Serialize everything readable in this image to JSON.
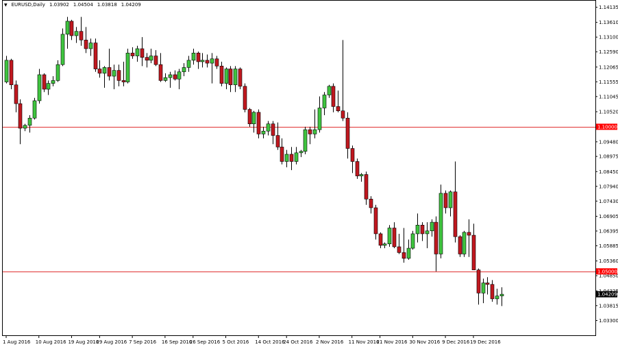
{
  "header": {
    "symbol": "EURUSD,Daily",
    "open": "1.03902",
    "high": "1.04504",
    "low": "1.03818",
    "close": "1.04209"
  },
  "colors": {
    "bull": "#3fc43f",
    "bear": "#c0181f",
    "wick": "#000000",
    "level_line": "#e03030",
    "level_label_bg": "#ff0000",
    "price_label_bg": "#000000"
  },
  "chart_data": {
    "type": "candlestick",
    "title": "EURUSD,Daily",
    "ylim": [
      1.0279,
      1.1436
    ],
    "y_ticks": [
      "1.14135",
      "1.13610",
      "1.13100",
      "1.12590",
      "1.12065",
      "1.11555",
      "1.11045",
      "1.10520",
      "1.09480",
      "1.08975",
      "1.08450",
      "1.07940",
      "1.07430",
      "1.06905",
      "1.06395",
      "1.05885",
      "1.05360",
      "1.04850",
      "1.04325",
      "1.03815",
      "1.03300"
    ],
    "x_tick_labels": [
      {
        "label": "1 Aug 2016",
        "i": 0
      },
      {
        "label": "10 Aug 2016",
        "i": 7
      },
      {
        "label": "19 Aug 2016",
        "i": 14
      },
      {
        "label": "29 Aug 2016",
        "i": 20
      },
      {
        "label": "7 Sep 2016",
        "i": 27
      },
      {
        "label": "16 Sep 2016",
        "i": 34
      },
      {
        "label": "26 Sep 2016",
        "i": 40
      },
      {
        "label": "5 Oct 2016",
        "i": 47
      },
      {
        "label": "14 Oct 2016",
        "i": 54
      },
      {
        "label": "24 Oct 2016",
        "i": 60
      },
      {
        "label": "2 Nov 2016",
        "i": 67
      },
      {
        "label": "11 Nov 2016",
        "i": 74
      },
      {
        "label": "21 Nov 2016",
        "i": 80
      },
      {
        "label": "30 Nov 2016",
        "i": 87
      },
      {
        "label": "9 Dec 2016",
        "i": 94
      },
      {
        "label": "19 Dec 2016",
        "i": 100
      }
    ],
    "levels": [
      {
        "value": 1.1,
        "label": "1.10000"
      },
      {
        "value": 1.05,
        "label": "1.05000"
      }
    ],
    "current_price": {
      "value": 1.04209,
      "label": "1.04209"
    },
    "candles": [
      [
        1.1155,
        1.1245,
        1.115,
        1.123
      ],
      [
        1.123,
        1.1235,
        1.113,
        1.1145
      ],
      [
        1.1145,
        1.116,
        1.105,
        1.108
      ],
      [
        1.108,
        1.1095,
        1.094,
        1.0995
      ],
      [
        1.0995,
        1.101,
        1.0985,
        1.1005
      ],
      [
        1.1005,
        1.104,
        1.098,
        1.103
      ],
      [
        1.103,
        1.11,
        1.1025,
        1.109
      ],
      [
        1.109,
        1.12,
        1.108,
        1.118
      ],
      [
        1.118,
        1.1185,
        1.112,
        1.113
      ],
      [
        1.113,
        1.116,
        1.111,
        1.115
      ],
      [
        1.115,
        1.1175,
        1.114,
        1.116
      ],
      [
        1.116,
        1.123,
        1.1155,
        1.1215
      ],
      [
        1.1215,
        1.134,
        1.121,
        1.132
      ],
      [
        1.132,
        1.138,
        1.127,
        1.1365
      ],
      [
        1.1365,
        1.137,
        1.13,
        1.1315
      ],
      [
        1.1315,
        1.1345,
        1.129,
        1.133
      ],
      [
        1.133,
        1.138,
        1.128,
        1.13
      ],
      [
        1.13,
        1.1345,
        1.1255,
        1.127
      ],
      [
        1.127,
        1.1305,
        1.1245,
        1.129
      ],
      [
        1.129,
        1.1305,
        1.119,
        1.12
      ],
      [
        1.12,
        1.123,
        1.117,
        1.1185
      ],
      [
        1.1185,
        1.121,
        1.1135,
        1.1205
      ],
      [
        1.1205,
        1.127,
        1.116,
        1.1175
      ],
      [
        1.1175,
        1.1215,
        1.113,
        1.1195
      ],
      [
        1.1195,
        1.1215,
        1.114,
        1.116
      ],
      [
        1.116,
        1.1225,
        1.114,
        1.1155
      ],
      [
        1.1155,
        1.127,
        1.115,
        1.1255
      ],
      [
        1.1255,
        1.1275,
        1.1235,
        1.1245
      ],
      [
        1.1245,
        1.128,
        1.1225,
        1.127
      ],
      [
        1.127,
        1.131,
        1.121,
        1.124
      ],
      [
        1.124,
        1.1255,
        1.1205,
        1.123
      ],
      [
        1.123,
        1.127,
        1.122,
        1.1245
      ],
      [
        1.1245,
        1.1265,
        1.121,
        1.1215
      ],
      [
        1.1215,
        1.1255,
        1.1155,
        1.116
      ],
      [
        1.116,
        1.1185,
        1.1155,
        1.117
      ],
      [
        1.117,
        1.119,
        1.1135,
        1.118
      ],
      [
        1.118,
        1.1195,
        1.116,
        1.1165
      ],
      [
        1.1165,
        1.12,
        1.113,
        1.119
      ],
      [
        1.119,
        1.122,
        1.1175,
        1.1205
      ],
      [
        1.1205,
        1.1245,
        1.119,
        1.123
      ],
      [
        1.123,
        1.127,
        1.1215,
        1.1255
      ],
      [
        1.1255,
        1.126,
        1.12,
        1.1225
      ],
      [
        1.1225,
        1.1255,
        1.1205,
        1.123
      ],
      [
        1.123,
        1.125,
        1.1205,
        1.122
      ],
      [
        1.122,
        1.1255,
        1.115,
        1.1235
      ],
      [
        1.1235,
        1.1245,
        1.12,
        1.121
      ],
      [
        1.121,
        1.1225,
        1.114,
        1.115
      ],
      [
        1.115,
        1.1205,
        1.113,
        1.12
      ],
      [
        1.12,
        1.121,
        1.112,
        1.1145
      ],
      [
        1.1145,
        1.121,
        1.112,
        1.12
      ],
      [
        1.12,
        1.1205,
        1.113,
        1.114
      ],
      [
        1.114,
        1.115,
        1.105,
        1.106
      ],
      [
        1.106,
        1.1065,
        1.1,
        1.101
      ],
      [
        1.101,
        1.1055,
        1.098,
        1.105
      ],
      [
        1.105,
        1.106,
        1.096,
        1.0975
      ],
      [
        1.0975,
        1.1,
        1.096,
        1.0985
      ],
      [
        1.0985,
        1.102,
        1.097,
        1.101
      ],
      [
        1.101,
        1.102,
        1.094,
        1.097
      ],
      [
        1.097,
        1.1015,
        1.092,
        1.093
      ],
      [
        1.093,
        1.096,
        1.087,
        1.088
      ],
      [
        1.088,
        1.092,
        1.086,
        1.0905
      ],
      [
        1.0905,
        1.093,
        1.085,
        1.088
      ],
      [
        1.088,
        1.093,
        1.087,
        1.091
      ],
      [
        1.091,
        1.092,
        1.0895,
        1.0915
      ],
      [
        1.0915,
        1.1,
        1.0905,
        1.099
      ],
      [
        1.099,
        1.1,
        1.094,
        1.0975
      ],
      [
        1.0975,
        1.106,
        1.096,
        1.099
      ],
      [
        1.099,
        1.1105,
        1.098,
        1.1065
      ],
      [
        1.1065,
        1.112,
        1.104,
        1.111
      ],
      [
        1.111,
        1.1145,
        1.11,
        1.114
      ],
      [
        1.114,
        1.115,
        1.105,
        1.107
      ],
      [
        1.107,
        1.1125,
        1.105,
        1.1055
      ],
      [
        1.1055,
        1.13,
        1.102,
        1.103
      ],
      [
        1.103,
        1.105,
        1.089,
        1.0925
      ],
      [
        1.0925,
        1.0935,
        1.084,
        1.088
      ],
      [
        1.088,
        1.089,
        1.082,
        1.083
      ],
      [
        1.083,
        1.084,
        1.081,
        1.0835
      ],
      [
        1.0835,
        1.0845,
        1.073,
        1.075
      ],
      [
        1.075,
        1.076,
        1.07,
        1.072
      ],
      [
        1.072,
        1.073,
        1.061,
        1.063
      ],
      [
        1.063,
        1.0635,
        1.058,
        1.059
      ],
      [
        1.059,
        1.06,
        1.058,
        1.0595
      ],
      [
        1.0595,
        1.066,
        1.0585,
        1.065
      ],
      [
        1.065,
        1.067,
        1.058,
        1.0585
      ],
      [
        1.0585,
        1.063,
        1.056,
        1.0565
      ],
      [
        1.0565,
        1.065,
        1.053,
        1.0545
      ],
      [
        1.0545,
        1.061,
        1.054,
        1.058
      ],
      [
        1.058,
        1.064,
        1.0575,
        1.063
      ],
      [
        1.063,
        1.07,
        1.06,
        1.066
      ],
      [
        1.066,
        1.067,
        1.0605,
        1.063
      ],
      [
        1.063,
        1.067,
        1.058,
        1.064
      ],
      [
        1.064,
        1.068,
        1.062,
        1.067
      ],
      [
        1.067,
        1.069,
        1.05,
        1.056
      ],
      [
        1.056,
        1.08,
        1.0545,
        1.077
      ],
      [
        1.077,
        1.078,
        1.07,
        1.072
      ],
      [
        1.072,
        1.078,
        1.069,
        1.0775
      ],
      [
        1.0775,
        1.088,
        1.06,
        1.062
      ],
      [
        1.062,
        1.0625,
        1.055,
        1.056
      ],
      [
        1.056,
        1.064,
        1.055,
        1.0635
      ],
      [
        1.0635,
        1.068,
        1.055,
        1.0625
      ],
      [
        1.0625,
        1.0665,
        1.053,
        1.0505
      ],
      [
        1.0505,
        1.051,
        1.0385,
        1.0425
      ],
      [
        1.0425,
        1.0475,
        1.039,
        1.046
      ],
      [
        1.046,
        1.048,
        1.042,
        1.0455
      ],
      [
        1.0455,
        1.047,
        1.0395,
        1.0405
      ],
      [
        1.0405,
        1.044,
        1.0385,
        1.0415
      ],
      [
        1.0415,
        1.0445,
        1.038,
        1.0421
      ]
    ]
  }
}
